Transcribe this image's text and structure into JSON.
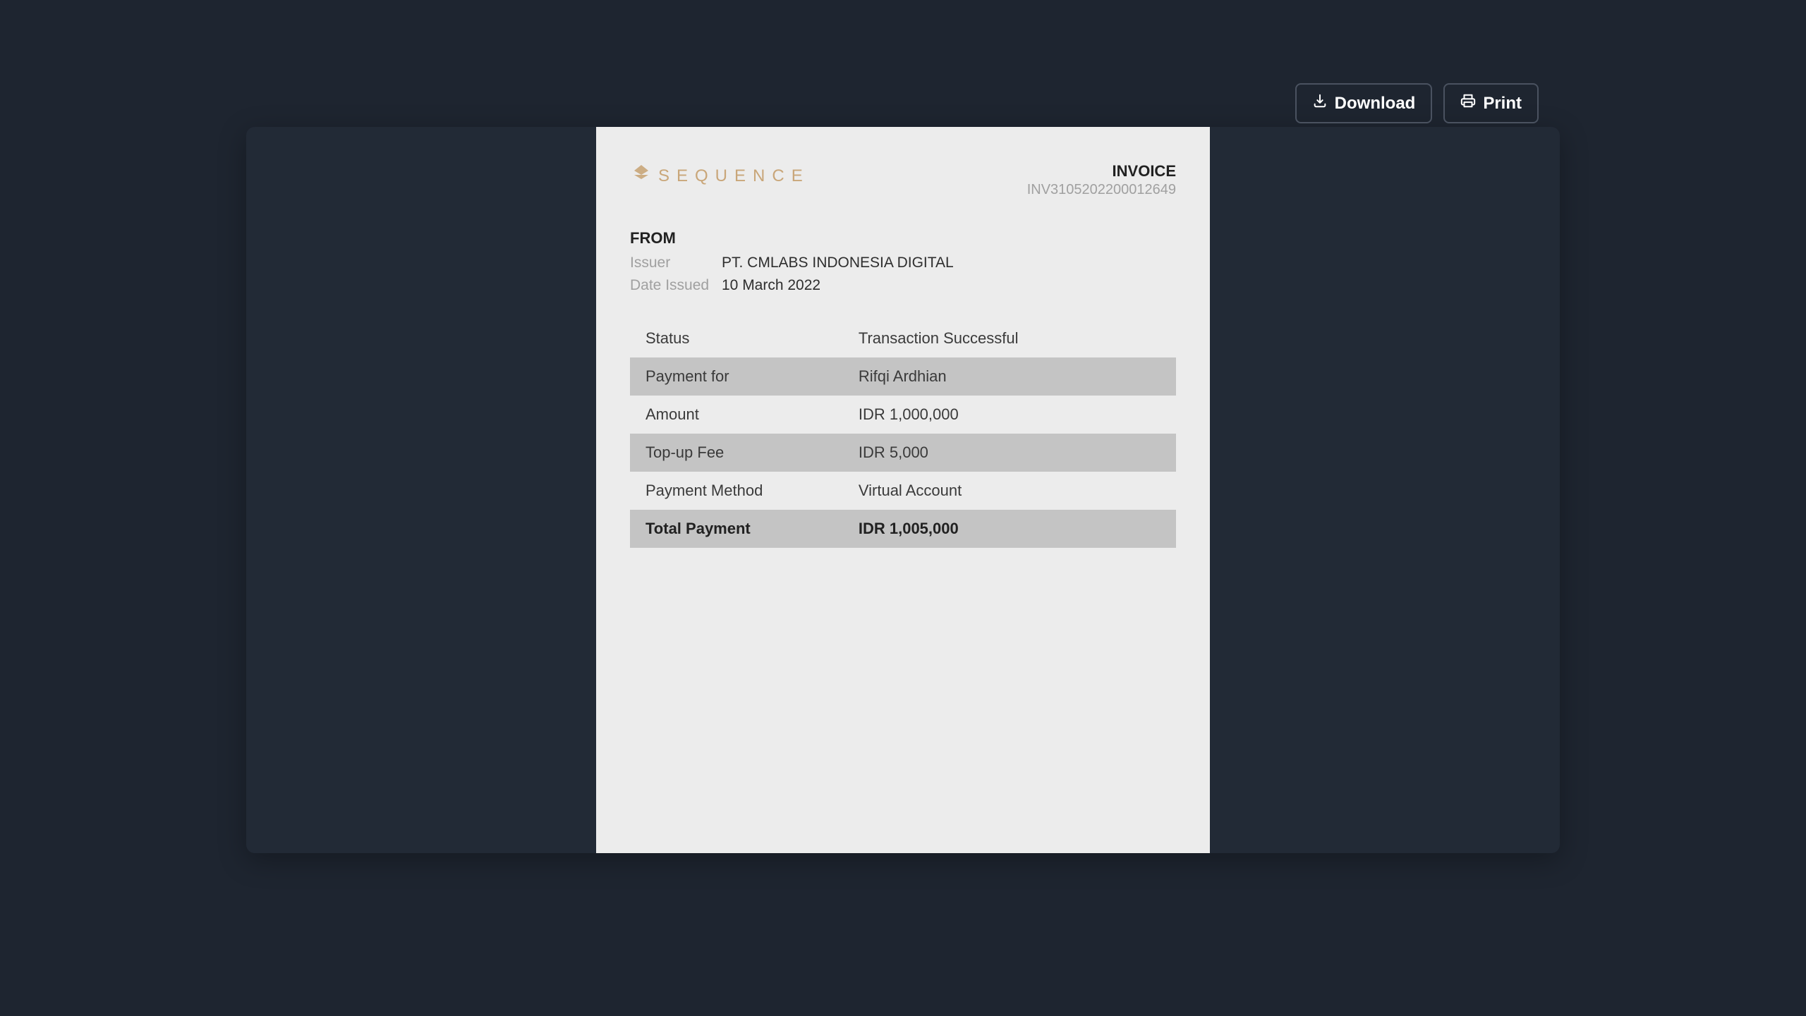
{
  "toolbar": {
    "download_label": "Download",
    "print_label": "Print"
  },
  "invoice": {
    "brand_name": "SEQUENCE",
    "title": "INVOICE",
    "number": "INV3105202200012649",
    "from_label": "FROM",
    "issuer_label": "Issuer",
    "issuer_value": "PT. CMLABS INDONESIA DIGITAL",
    "date_label": "Date Issued",
    "date_value": "10 March 2022",
    "rows": [
      {
        "label": "Status",
        "value": "Transaction Successful"
      },
      {
        "label": "Payment for",
        "value": "Rifqi Ardhian"
      },
      {
        "label": "Amount",
        "value": "IDR 1,000,000"
      },
      {
        "label": "Top-up Fee",
        "value": "IDR 5,000"
      },
      {
        "label": "Payment Method",
        "value": "Virtual Account"
      },
      {
        "label": "Total Payment",
        "value": "IDR 1,005,000"
      }
    ]
  }
}
